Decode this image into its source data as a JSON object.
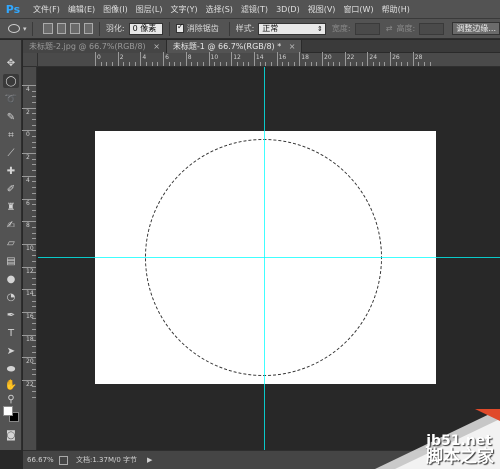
{
  "app": {
    "logo": "Ps"
  },
  "menu": [
    "文件(F)",
    "编辑(E)",
    "图像(I)",
    "图层(L)",
    "文字(Y)",
    "选择(S)",
    "滤镜(T)",
    "3D(D)",
    "视图(V)",
    "窗口(W)",
    "帮助(H)"
  ],
  "options": {
    "feather_label": "羽化:",
    "feather_value": "0 像素",
    "antialias_label": "消除锯齿",
    "style_label": "样式:",
    "style_value": "正常",
    "width_label": "宽度:",
    "height_label": "高度:",
    "refine_button": "调整边缘..."
  },
  "tabs": [
    {
      "label": "未标题-2.jpg @ 66.7%(RGB/8)",
      "close": "×"
    },
    {
      "label": "未标题-1 @ 66.7%(RGB/8) *",
      "close": "×"
    }
  ],
  "ruler": {
    "top": [
      "0",
      "2",
      "4",
      "6",
      "8",
      "10",
      "12",
      "14",
      "16",
      "18",
      "20",
      "22",
      "24",
      "26",
      "28"
    ],
    "left": [
      "4",
      "2",
      "0",
      "2",
      "4",
      "6",
      "8",
      "10",
      "12",
      "14",
      "16",
      "18",
      "20",
      "22"
    ]
  },
  "status": {
    "zoom": "66.67%",
    "doc": "文档:1.37M/0 字节",
    "arrow": "▶"
  },
  "colors": {
    "foreground": "#ffffff",
    "background": "#000000",
    "guide": "#00ffff"
  },
  "watermark": {
    "url": "jb51.net",
    "name": "脚本之家"
  }
}
